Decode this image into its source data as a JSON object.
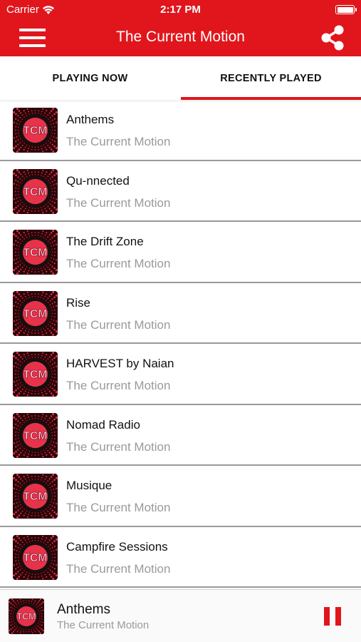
{
  "status_bar": {
    "carrier": "Carrier",
    "time": "2:17 PM",
    "wifi_icon": "wifi-icon",
    "battery_icon": "battery-icon"
  },
  "navbar": {
    "title": "The Current Motion",
    "menu_icon": "hamburger-menu-icon",
    "share_icon": "share-icon"
  },
  "tabs": [
    {
      "label": "PLAYING NOW",
      "active": false
    },
    {
      "label": "RECENTLY PLAYED",
      "active": true
    }
  ],
  "logo_text": "TCM",
  "stations": [
    {
      "name": "Anthems",
      "subtitle": "The Current Motion"
    },
    {
      "name": "Qu-nnected",
      "subtitle": "The Current Motion"
    },
    {
      "name": "The Drift Zone",
      "subtitle": "The Current Motion"
    },
    {
      "name": "Rise",
      "subtitle": "The Current Motion"
    },
    {
      "name": "HARVEST by Naian",
      "subtitle": "The Current Motion"
    },
    {
      "name": "Nomad Radio",
      "subtitle": "The Current Motion"
    },
    {
      "name": "Musique",
      "subtitle": "The Current Motion"
    },
    {
      "name": "Campfire Sessions",
      "subtitle": "The Current Motion"
    }
  ],
  "now_playing": {
    "name": "Anthems",
    "subtitle": "The Current Motion",
    "control_icon": "pause-icon"
  },
  "colors": {
    "accent": "#e0161c",
    "subtitle_gray": "#9a9a9a",
    "divider": "#9a9a9a"
  }
}
